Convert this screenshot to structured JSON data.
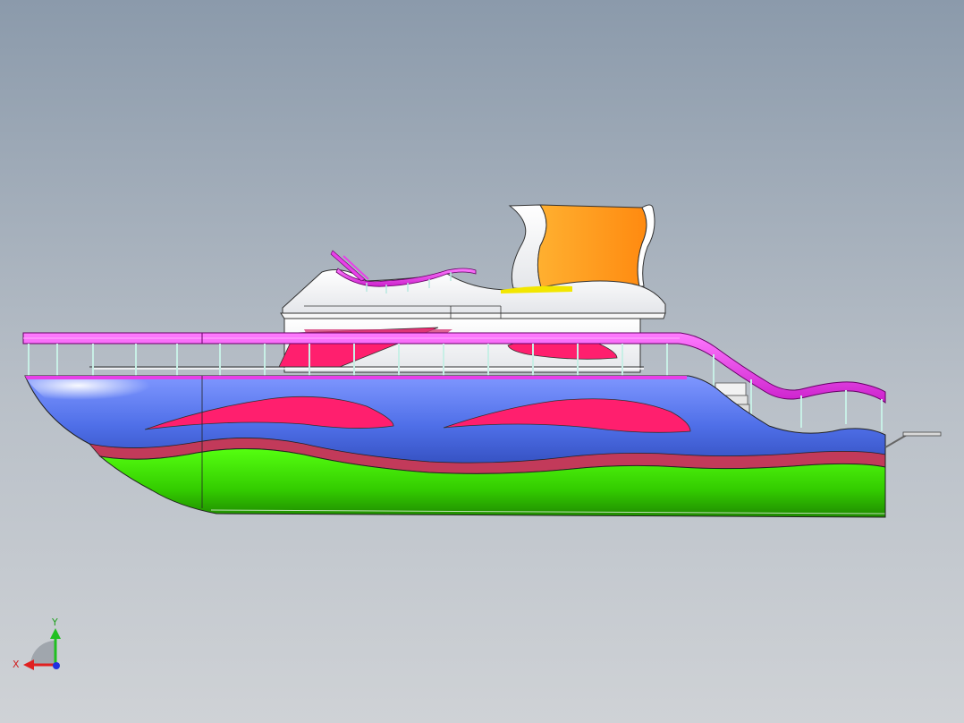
{
  "viewport": {
    "background_top": "#8b9aab",
    "background_bottom": "#cfd2d6"
  },
  "model": {
    "name": "yacht",
    "colors": {
      "hull_upper": "#4f6fe8",
      "hull_lower": "#33cc00",
      "waterline_stripe": "#cc3355",
      "flame_decals": "#ff1f6e",
      "rails": "#e840e8",
      "funnel": "#ff9a1a",
      "superstructure": "#ffffff",
      "railing_posts": "#c8efe6"
    }
  },
  "triad": {
    "x_label": "X",
    "y_label": "Y",
    "x_color": "#e02020",
    "y_color": "#20c020",
    "z_color": "#2030e0"
  }
}
